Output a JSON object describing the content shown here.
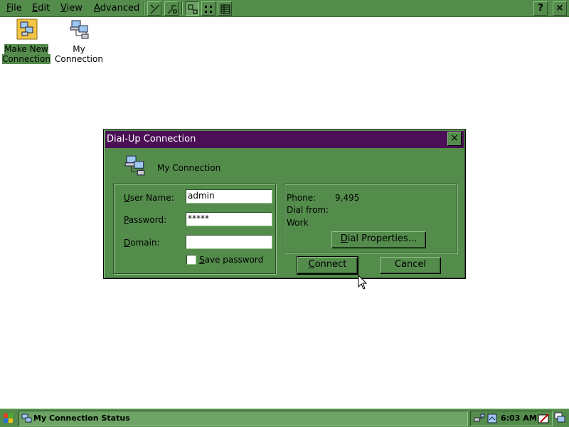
{
  "menubar": {
    "menus": [
      "File",
      "Edit",
      "View",
      "Advanced"
    ],
    "help_label": "?",
    "close_label": "×"
  },
  "desktop": {
    "icons": [
      {
        "label": "Make New Connection",
        "selected": true
      },
      {
        "label": "My Connection",
        "selected": false
      }
    ]
  },
  "dialog": {
    "title": "Dial-Up Connection",
    "close_label": "×",
    "connection_name": "My Connection",
    "username_label": "User Name:",
    "username_value": "admin",
    "password_label": "Password:",
    "password_value": "*****",
    "domain_label": "Domain:",
    "domain_value": "",
    "save_password_label": "Save password",
    "save_password_checked": false,
    "phone_label": "Phone:",
    "phone_value": "9,495",
    "dial_from_label": "Dial from:",
    "dial_from_value": "Work",
    "dial_properties_label": "Dial Properties...",
    "connect_label": "Connect",
    "cancel_label": "Cancel"
  },
  "taskbar": {
    "task_label": "My Connection Status",
    "clock": "6:03 AM"
  },
  "colors": {
    "face": "#548c4c",
    "titlebar": "#4a0f55"
  }
}
